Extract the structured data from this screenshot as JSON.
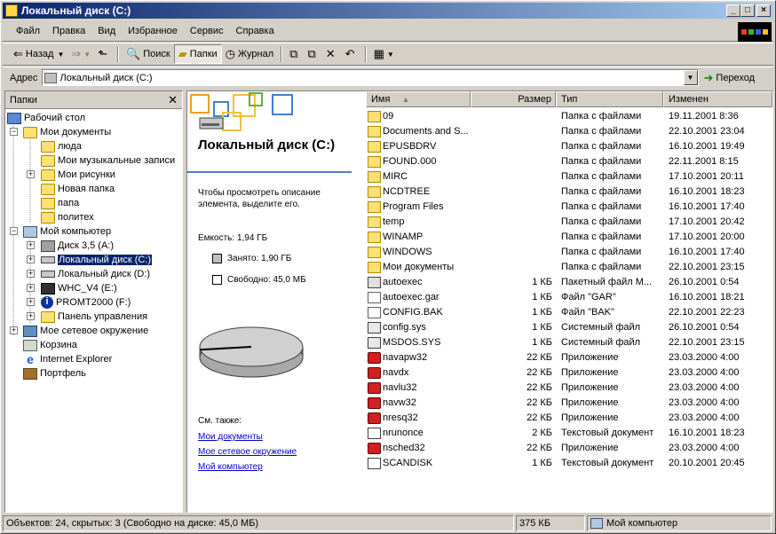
{
  "window": {
    "title": "Локальный диск (C:)"
  },
  "menu": [
    "Файл",
    "Правка",
    "Вид",
    "Избранное",
    "Сервис",
    "Справка"
  ],
  "toolbar": {
    "back": "Назад",
    "search": "Поиск",
    "folders": "Папки",
    "history": "Журнал"
  },
  "address": {
    "label": "Адрес",
    "value": "Локальный диск (C:)",
    "go": "Переход"
  },
  "folder_pane": {
    "title": "Папки",
    "items": [
      {
        "label": "Рабочий стол"
      },
      {
        "label": "Мои документы"
      },
      {
        "label": "люда"
      },
      {
        "label": "Мои музыкальные записи"
      },
      {
        "label": "Мои рисунки"
      },
      {
        "label": "Новая папка"
      },
      {
        "label": "папа"
      },
      {
        "label": "политех"
      },
      {
        "label": "Мой компьютер"
      },
      {
        "label": "Диск 3,5 (A:)"
      },
      {
        "label": "Локальный диск (C:)"
      },
      {
        "label": "Локальный диск (D:)"
      },
      {
        "label": "WHC_V4 (E:)"
      },
      {
        "label": "PROMT2000 (F:)"
      },
      {
        "label": "Панель управления"
      },
      {
        "label": "Мое сетевое окружение"
      },
      {
        "label": "Корзина"
      },
      {
        "label": "Internet Explorer"
      },
      {
        "label": "Портфель"
      }
    ]
  },
  "info": {
    "title": "Локальный диск (C:)",
    "description": "Чтобы просмотреть описание элемента, выделите его.",
    "capacity": "Емкость: 1,94 ГБ",
    "used": "Занято: 1,90 ГБ",
    "free": "Свободно: 45,0 МБ",
    "used_fraction": 0.977,
    "see_also": "См. также:",
    "links": [
      "Мои документы",
      "Мое сетевое окружение",
      "Мой компьютер"
    ]
  },
  "columns": {
    "name": "Имя",
    "size": "Размер",
    "type": "Тип",
    "modified": "Изменен"
  },
  "files": [
    {
      "name": "09",
      "size": "",
      "type": "Папка с файлами",
      "modified": "19.11.2001 8:36",
      "icon": "folder"
    },
    {
      "name": "Documents and S...",
      "size": "",
      "type": "Папка с файлами",
      "modified": "22.10.2001 23:04",
      "icon": "folder"
    },
    {
      "name": "EPUSBDRV",
      "size": "",
      "type": "Папка с файлами",
      "modified": "16.10.2001 19:49",
      "icon": "folder"
    },
    {
      "name": "FOUND.000",
      "size": "",
      "type": "Папка с файлами",
      "modified": "22.11.2001 8:15",
      "icon": "folder"
    },
    {
      "name": "MIRC",
      "size": "",
      "type": "Папка с файлами",
      "modified": "17.10.2001 20:11",
      "icon": "folder"
    },
    {
      "name": "NCDTREE",
      "size": "",
      "type": "Папка с файлами",
      "modified": "16.10.2001 18:23",
      "icon": "folder"
    },
    {
      "name": "Program Files",
      "size": "",
      "type": "Папка с файлами",
      "modified": "16.10.2001 17:40",
      "icon": "folder"
    },
    {
      "name": "temp",
      "size": "",
      "type": "Папка с файлами",
      "modified": "17.10.2001 20:42",
      "icon": "folder"
    },
    {
      "name": "WINAMP",
      "size": "",
      "type": "Папка с файлами",
      "modified": "17.10.2001 20:00",
      "icon": "folder"
    },
    {
      "name": "WINDOWS",
      "size": "",
      "type": "Папка с файлами",
      "modified": "16.10.2001 17:40",
      "icon": "folder"
    },
    {
      "name": "Мои документы",
      "size": "",
      "type": "Папка с файлами",
      "modified": "22.10.2001 23:15",
      "icon": "folder"
    },
    {
      "name": "autoexec",
      "size": "1 КБ",
      "type": "Пакетный файл М...",
      "modified": "26.10.2001 0:54",
      "icon": "batch"
    },
    {
      "name": "autoexec.gar",
      "size": "1 КБ",
      "type": "Файл \"GAR\"",
      "modified": "16.10.2001 18:21",
      "icon": "file"
    },
    {
      "name": "CONFIG.BAK",
      "size": "1 КБ",
      "type": "Файл \"BAK\"",
      "modified": "22.10.2001 22:23",
      "icon": "file"
    },
    {
      "name": "config.sys",
      "size": "1 КБ",
      "type": "Системный файл",
      "modified": "26.10.2001 0:54",
      "icon": "sys"
    },
    {
      "name": "MSDOS.SYS",
      "size": "1 КБ",
      "type": "Системный файл",
      "modified": "22.10.2001 23:15",
      "icon": "sys"
    },
    {
      "name": "navapw32",
      "size": "22 КБ",
      "type": "Приложение",
      "modified": "23.03.2000 4:00",
      "icon": "app"
    },
    {
      "name": "navdx",
      "size": "22 КБ",
      "type": "Приложение",
      "modified": "23.03.2000 4:00",
      "icon": "app"
    },
    {
      "name": "navlu32",
      "size": "22 КБ",
      "type": "Приложение",
      "modified": "23.03.2000 4:00",
      "icon": "app"
    },
    {
      "name": "navw32",
      "size": "22 КБ",
      "type": "Приложение",
      "modified": "23.03.2000 4:00",
      "icon": "app"
    },
    {
      "name": "nresq32",
      "size": "22 КБ",
      "type": "Приложение",
      "modified": "23.03.2000 4:00",
      "icon": "app"
    },
    {
      "name": "nrunonce",
      "size": "2 КБ",
      "type": "Текстовый документ",
      "modified": "16.10.2001 18:23",
      "icon": "text"
    },
    {
      "name": "nsched32",
      "size": "22 КБ",
      "type": "Приложение",
      "modified": "23.03.2000 4:00",
      "icon": "app"
    },
    {
      "name": "SCANDISK",
      "size": "1 КБ",
      "type": "Текстовый документ",
      "modified": "20.10.2001 20:45",
      "icon": "text"
    }
  ],
  "status": {
    "objects": "Объектов: 24, скрытых: 3 (Свободно на диске: 45,0 МБ)",
    "size": "375 КБ",
    "location": "Мой компьютер"
  }
}
